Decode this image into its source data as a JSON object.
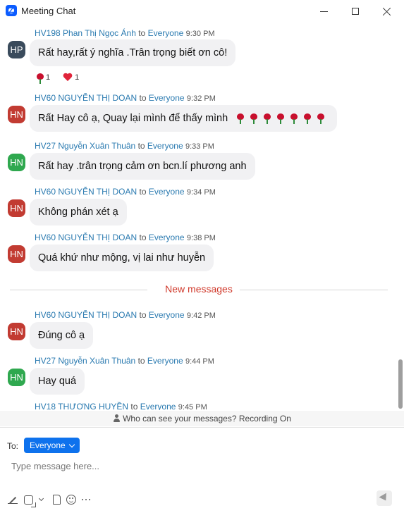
{
  "window": {
    "title": "Meeting Chat",
    "icon": "zoom-logo-icon"
  },
  "messages": [
    {
      "sender": "HV198 Phan Thị Ngọc Ánh",
      "to_word": "to",
      "recipient": "Everyone",
      "time": "9:30 PM",
      "initials": "HP",
      "avatar_color": "#3a4b5c",
      "text": "Rất hay,rất ý nghĩa .Trân trọng biết ơn cô!",
      "reactions": [
        {
          "icon": "rose-icon",
          "count": "1"
        },
        {
          "icon": "heart-icon",
          "count": "1"
        }
      ]
    },
    {
      "sender": "HV60 NGUYỄN THỊ DOAN",
      "to_word": "to",
      "recipient": "Everyone",
      "time": "9:32 PM",
      "initials": "HN",
      "avatar_color": "#c23b32",
      "text": "Rất Hay cô ạ, Quay lại mình để thấy mình",
      "emoji": "rose-icon",
      "emoji_count": 7
    },
    {
      "sender": "HV27 Nguyễn Xuân Thuân",
      "to_word": "to",
      "recipient": "Everyone",
      "time": "9:33 PM",
      "initials": "HN",
      "avatar_color": "#2fa84f",
      "text": "Rất hay .trân trọng cảm ơn bcn.lí phương anh"
    },
    {
      "sender": "HV60 NGUYỄN THỊ DOAN",
      "to_word": "to",
      "recipient": "Everyone",
      "time": "9:34 PM",
      "initials": "HN",
      "avatar_color": "#c23b32",
      "text": "Không phán xét ạ"
    },
    {
      "sender": "HV60 NGUYỄN THỊ DOAN",
      "to_word": "to",
      "recipient": "Everyone",
      "time": "9:38 PM",
      "initials": "HN",
      "avatar_color": "#c23b32",
      "text": "Quá khứ như mộng, vị lai như huyễn"
    },
    {
      "sender": "HV60 NGUYỄN THỊ DOAN",
      "to_word": "to",
      "recipient": "Everyone",
      "time": "9:42 PM",
      "initials": "HN",
      "avatar_color": "#c23b32",
      "text": "Đúng cô ạ"
    },
    {
      "sender": "HV27 Nguyễn Xuân Thuân",
      "to_word": "to",
      "recipient": "Everyone",
      "time": "9:44 PM",
      "initials": "HN",
      "avatar_color": "#2fa84f",
      "text": "Hay quá"
    },
    {
      "sender": "HV18 THƯƠNG HUYỀN",
      "to_word": "to",
      "recipient": "Everyone",
      "time": "9:45 PM"
    }
  ],
  "divider": {
    "label": "New messages",
    "color": "#d0392b"
  },
  "privacy": {
    "text": "Who can see your messages? Recording On"
  },
  "composer": {
    "to_label": "To:",
    "recipient": "Everyone",
    "placeholder": "Type message here...",
    "accent": "#0e72ed"
  }
}
